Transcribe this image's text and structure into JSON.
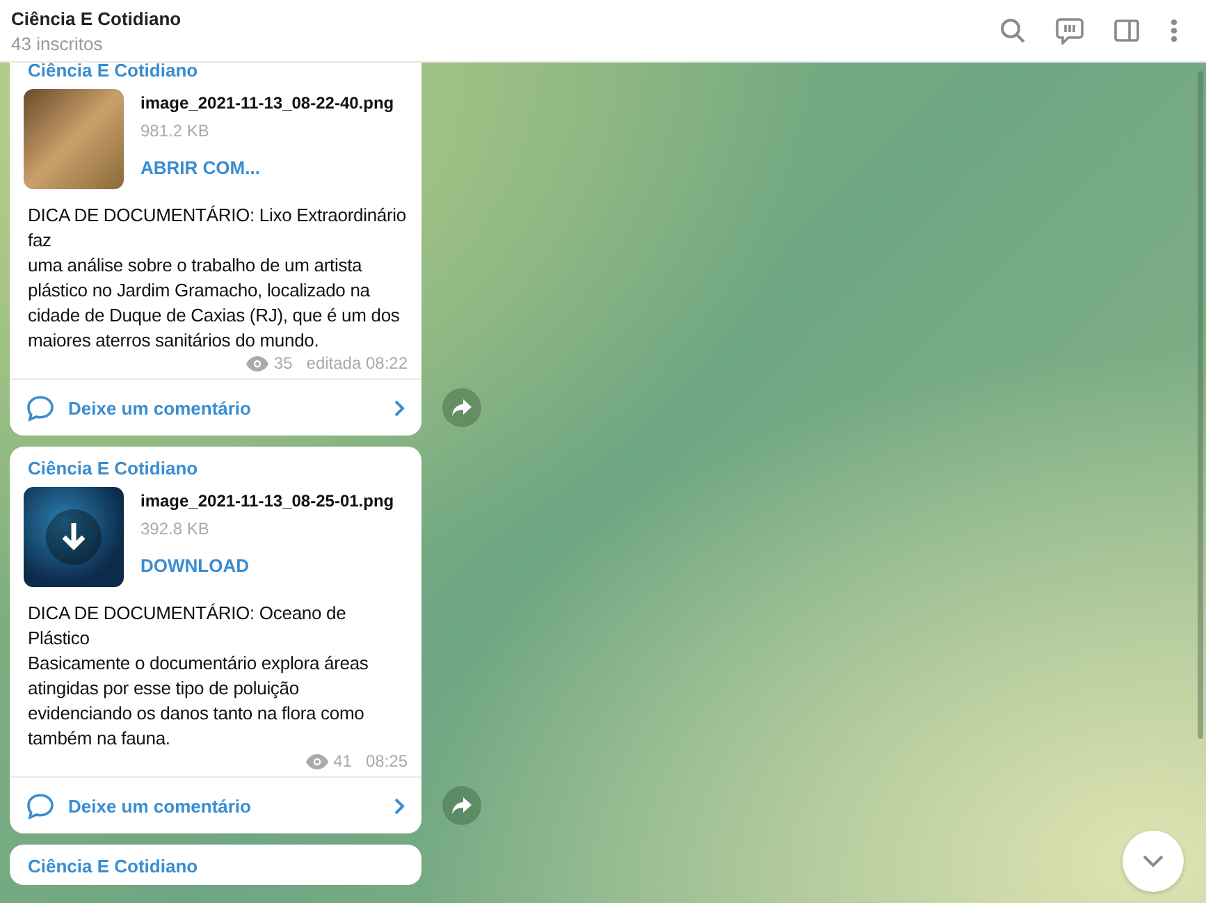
{
  "header": {
    "title": "Ciência E Cotidiano",
    "subtitle": "43 inscritos"
  },
  "messages": [
    {
      "channel": "Ciência E Cotidiano",
      "file": {
        "name": "image_2021-11-13_08-22-40.png",
        "size": "981.2 KB",
        "action": "ABRIR COM...",
        "kind": "photo"
      },
      "text": "DICA DE DOCUMENTÁRIO: Lixo Extraordinário faz\numa análise sobre o trabalho de um artista plástico no Jardim Gramacho, localizado na cidade de Duque de Caxias (RJ), que é um dos maiores aterros sanitários do mundo.",
      "views": "35",
      "time": "editada 08:22",
      "comment": "Deixe um comentário"
    },
    {
      "channel": "Ciência E Cotidiano",
      "file": {
        "name": "image_2021-11-13_08-25-01.png",
        "size": "392.8 KB",
        "action": "DOWNLOAD",
        "kind": "download"
      },
      "text": "DICA DE DOCUMENTÁRIO: Oceano de Plástico\nBasicamente o documentário explora áreas atingidas por esse tipo de poluição evidenciando os danos tanto na flora como também na fauna.",
      "views": "41",
      "time": "08:25",
      "comment": "Deixe um comentário"
    },
    {
      "channel": "Ciência E Cotidiano"
    }
  ]
}
